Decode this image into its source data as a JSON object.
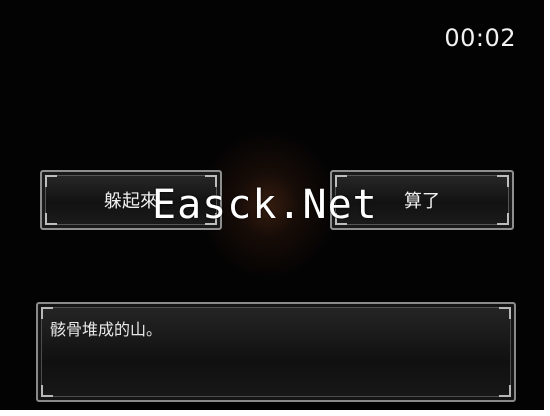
{
  "hud": {
    "timer": "00:02"
  },
  "choices": [
    {
      "label": "躲起來"
    },
    {
      "label": "算了"
    }
  ],
  "watermark": "Easck.Net",
  "message": {
    "text": "骸骨堆成的山。"
  },
  "colors": {
    "background": "#030303",
    "frame": "#8f8f8f",
    "text": "#f0f0f0"
  }
}
